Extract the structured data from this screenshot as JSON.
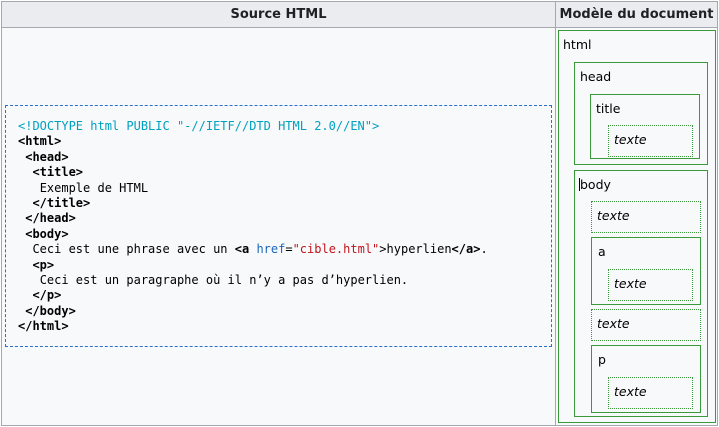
{
  "headers": {
    "source": "Source HTML",
    "model": "Modèle du document"
  },
  "code": {
    "doctype": "<!DOCTYPE html PUBLIC \"-//IETF//DTD HTML 2.0//EN\">",
    "html_open": "<html>",
    "head_open": "<head>",
    "title_open": "<title>",
    "title_text": "Exemple de HTML",
    "title_close": "</title>",
    "head_close": "</head>",
    "body_open": "<body>",
    "body_text_before": "Ceci est une phrase avec un ",
    "a_open_start": "<a",
    "a_attr_name": "href",
    "a_attr_eq": "=",
    "a_attr_value": "\"cible.html\"",
    "a_open_end": ">",
    "a_text": "hyperlien",
    "a_close": "</a>",
    "body_text_after": ".",
    "p_open": "<p>",
    "p_text": "Ceci est un paragraphe où il n’y a pas d’hyperlien.",
    "p_close": "</p>",
    "body_close": "</body>",
    "html_close": "</html>"
  },
  "tree": {
    "html": "html",
    "head": "head",
    "title": "title",
    "title_text": "texte",
    "body": "body",
    "body_text1": "texte",
    "a": "a",
    "a_text": "texte",
    "body_text2": "texte",
    "p": "p",
    "p_text": "texte"
  }
}
